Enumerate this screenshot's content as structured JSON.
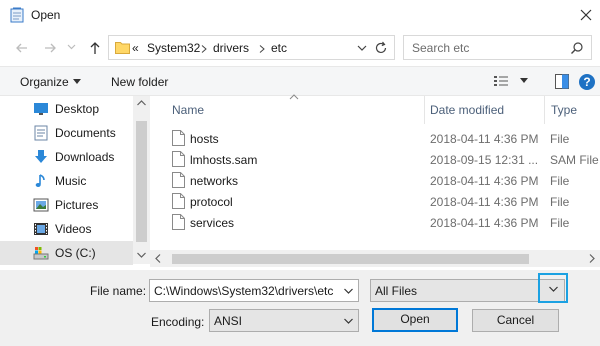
{
  "window": {
    "title": "Open"
  },
  "address": {
    "overflow": "«",
    "segments": [
      "System32",
      "drivers",
      "etc"
    ]
  },
  "search": {
    "placeholder": "Search etc"
  },
  "toolbar": {
    "organize_label": "Organize",
    "new_folder_label": "New folder"
  },
  "sidebar": {
    "items": [
      {
        "label": "Desktop",
        "icon": "desktop-icon"
      },
      {
        "label": "Documents",
        "icon": "documents-icon"
      },
      {
        "label": "Downloads",
        "icon": "downloads-icon"
      },
      {
        "label": "Music",
        "icon": "music-icon"
      },
      {
        "label": "Pictures",
        "icon": "pictures-icon"
      },
      {
        "label": "Videos",
        "icon": "videos-icon"
      },
      {
        "label": "OS (C:)",
        "icon": "drive-icon",
        "selected": true
      }
    ]
  },
  "file_list": {
    "columns": [
      "Name",
      "Date modified",
      "Type"
    ],
    "rows": [
      {
        "name": "hosts",
        "date": "2018-04-11 4:36 PM",
        "type": "File"
      },
      {
        "name": "lmhosts.sam",
        "date": "2018-09-15 12:31 ...",
        "type": "SAM File"
      },
      {
        "name": "networks",
        "date": "2018-04-11 4:36 PM",
        "type": "File"
      },
      {
        "name": "protocol",
        "date": "2018-04-11 4:36 PM",
        "type": "File"
      },
      {
        "name": "services",
        "date": "2018-04-11 4:36 PM",
        "type": "File"
      }
    ]
  },
  "bottom": {
    "file_name_label": "File name:",
    "file_name_value": "C:\\Windows\\System32\\drivers\\etc",
    "filter_value": "All Files",
    "encoding_label": "Encoding:",
    "encoding_value": "ANSI",
    "open_label": "Open",
    "cancel_label": "Cancel"
  },
  "colors": {
    "accent": "#0078d7",
    "highlight": "#1ba1e2",
    "folder": "#ffd766"
  }
}
